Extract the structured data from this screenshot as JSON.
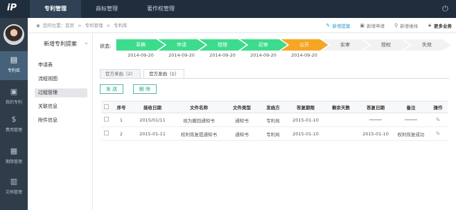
{
  "topbar": {
    "logo": "iP",
    "nav": [
      "专利管理",
      "商标管理",
      "著作权管理"
    ],
    "active_index": 0
  },
  "sidebar": {
    "items": [
      {
        "label": "专利库",
        "icon": "patent-library-icon",
        "glyph": "▤",
        "active": true
      },
      {
        "label": "我的专利",
        "icon": "my-patent-icon",
        "glyph": "▣",
        "active": false
      },
      {
        "label": "费用管理",
        "icon": "fee-icon",
        "glyph": "$",
        "active": false
      },
      {
        "label": "期限管理",
        "icon": "calendar-icon",
        "glyph": "▦",
        "active": false
      },
      {
        "label": "文档管理",
        "icon": "document-icon",
        "glyph": "▥",
        "active": false
      }
    ]
  },
  "breadcrumb": {
    "prefix": "您的位置：首页",
    "level1": "专利管理",
    "level2": "专利库"
  },
  "actions": [
    {
      "label": "新增提案",
      "icon": "edit-icon",
      "glyph": "✎",
      "highlight": true
    },
    {
      "label": "新增申请",
      "icon": "add-file-icon",
      "glyph": "▣",
      "highlight": false
    },
    {
      "label": "新增维持",
      "icon": "chart-icon",
      "glyph": "⚲",
      "highlight": false
    },
    {
      "label": "更多业务",
      "icon": "plus-icon",
      "glyph": "+",
      "highlight": false
    }
  ],
  "submenu": {
    "title": "新增专利提案",
    "items": [
      "申请表",
      "流程视图",
      "过程管理",
      "关联信息",
      "附件信息"
    ],
    "active_index": 2
  },
  "status": {
    "label": "状态:",
    "steps": [
      {
        "name": "草稿",
        "date": "2014-09-20",
        "state": "done"
      },
      {
        "name": "申请",
        "date": "2014-09-20",
        "state": "done"
      },
      {
        "name": "授理",
        "date": "2014-09-20",
        "state": "done"
      },
      {
        "name": "初审",
        "date": "2014-09-20",
        "state": "done"
      },
      {
        "name": "公开",
        "date": "2014-09-20",
        "state": "current"
      },
      {
        "name": "实审",
        "date": "",
        "state": "todo"
      },
      {
        "name": "授权",
        "date": "",
        "state": "todo"
      },
      {
        "name": "失效",
        "date": "",
        "state": "todo"
      }
    ],
    "colors": {
      "done": "#3ddb8c",
      "current": "#f5a623",
      "todo": "#f2f2f2"
    }
  },
  "tabs": [
    "官方来函（2）",
    "官方发函（1）"
  ],
  "tab_active": 1,
  "buttons": {
    "send": "发 送",
    "delete": "删 除"
  },
  "table": {
    "headers": [
      "序号",
      "接收日期",
      "文件名称",
      "文件类型",
      "发函方",
      "答复期限",
      "剩余天数",
      "答复日期",
      "备注",
      "操作"
    ],
    "rows": [
      [
        "1",
        "2015/01/11",
        "视为撤回通知书",
        "通知书",
        "专利局",
        "2015-01-10",
        "",
        "",
        "",
        ""
      ],
      [
        "2",
        "2015-01-11",
        "权利恢复提通知书",
        "通知书",
        "专利局",
        "2015-01-10",
        "",
        "2015-01-10",
        "权利恢复成功",
        ""
      ]
    ]
  }
}
